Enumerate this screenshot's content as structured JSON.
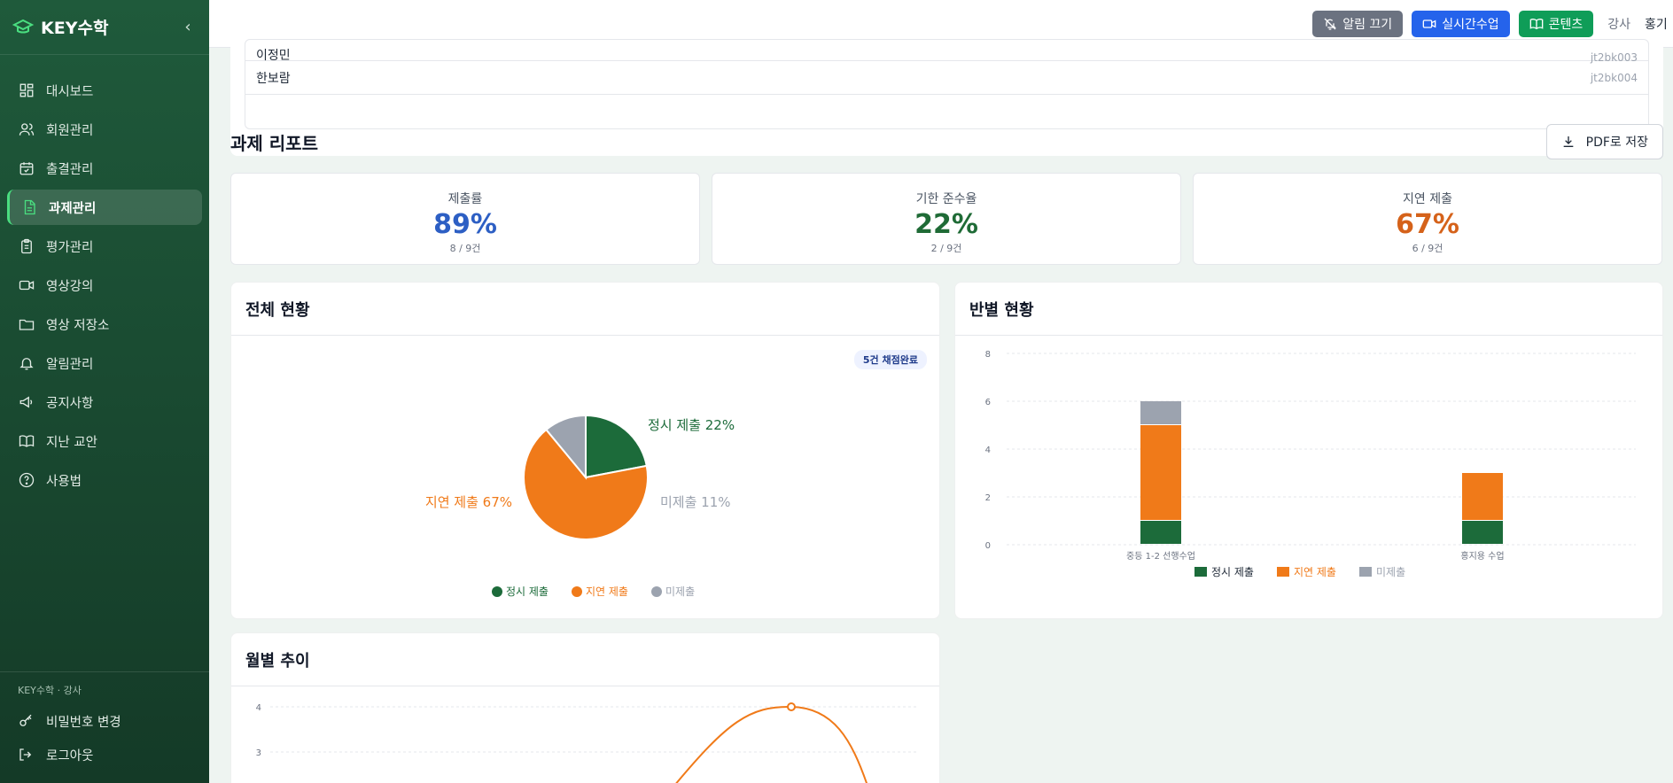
{
  "brand": {
    "name": "KEY수학",
    "collapse_icon": "chevron-left-icon"
  },
  "nav": [
    {
      "label": "대시보드",
      "icon": "dashboard-icon",
      "active": false
    },
    {
      "label": "회원관리",
      "icon": "users-icon",
      "active": false
    },
    {
      "label": "출결관리",
      "icon": "calendar-check-icon",
      "active": false
    },
    {
      "label": "과제관리",
      "icon": "document-icon",
      "active": true
    },
    {
      "label": "평가관리",
      "icon": "clipboard-icon",
      "active": false
    },
    {
      "label": "영상강의",
      "icon": "video-icon",
      "active": false
    },
    {
      "label": "영상 저장소",
      "icon": "folder-icon",
      "active": false
    },
    {
      "label": "알림관리",
      "icon": "bell-icon",
      "active": false
    },
    {
      "label": "공지사항",
      "icon": "megaphone-icon",
      "active": false
    },
    {
      "label": "지난 교안",
      "icon": "book-icon",
      "active": false
    },
    {
      "label": "사용법",
      "icon": "help-icon",
      "active": false
    }
  ],
  "sidebar_footer": {
    "caption": "KEY수학 · 강사",
    "change_password": "비밀번호 변경",
    "logout": "로그아웃"
  },
  "topbar": {
    "mute_label": "알림 끄기",
    "live_label": "실시간수업",
    "content_label": "콘텐츠",
    "role": "강사",
    "user_name": "홍기"
  },
  "students": [
    {
      "name": "이정민",
      "id": "jt2bk003"
    },
    {
      "name": "한보람",
      "id": "jt2bk004"
    }
  ],
  "report": {
    "title": "과제 리포트",
    "pdf_label": "PDF로 저장",
    "stats": [
      {
        "label": "제출률",
        "value": "89%",
        "sub": "8 / 9건",
        "color": "#2d5fc4"
      },
      {
        "label": "기한 준수율",
        "value": "22%",
        "sub": "2 / 9건",
        "color": "#1f6b36"
      },
      {
        "label": "지연 제출",
        "value": "67%",
        "sub": "6 / 9건",
        "color": "#d5621a"
      }
    ]
  },
  "colors": {
    "ontime": "#1c6b3a",
    "late": "#f07a19",
    "missing": "#9ca3af",
    "sidebar": "#1f5a3b"
  },
  "panels": {
    "overall_title": "전체 현황",
    "graded_badge": "5건 채점완료",
    "class_title": "반별 현황",
    "monthly_title": "월별 추이"
  },
  "chart_data": [
    {
      "type": "pie",
      "labels": [
        "정시 제출",
        "지연 제출",
        "미제출"
      ],
      "values": [
        22,
        67,
        11
      ],
      "slice_labels": [
        "정시 제출 22%",
        "지연 제출 67%",
        "미제출 11%"
      ],
      "legend": [
        "정시 제출",
        "지연 제출",
        "미제출"
      ],
      "legend_position": "bottom"
    },
    {
      "type": "bar",
      "stacked": true,
      "categories": [
        "중등 1-2 선행수업",
        "홍지용 수업"
      ],
      "series": [
        {
          "name": "정시 제출",
          "values": [
            1,
            1
          ]
        },
        {
          "name": "지연 제출",
          "values": [
            4,
            2
          ]
        },
        {
          "name": "미제출",
          "values": [
            1,
            0
          ]
        }
      ],
      "ylim": [
        0,
        8
      ],
      "yticks": [
        "0",
        "2",
        "4",
        "6",
        "8"
      ],
      "grid": true,
      "legend_position": "bottom"
    },
    {
      "type": "line",
      "yticks_visible": [
        "4",
        "3"
      ],
      "peak_value": 4,
      "grid": true
    }
  ]
}
